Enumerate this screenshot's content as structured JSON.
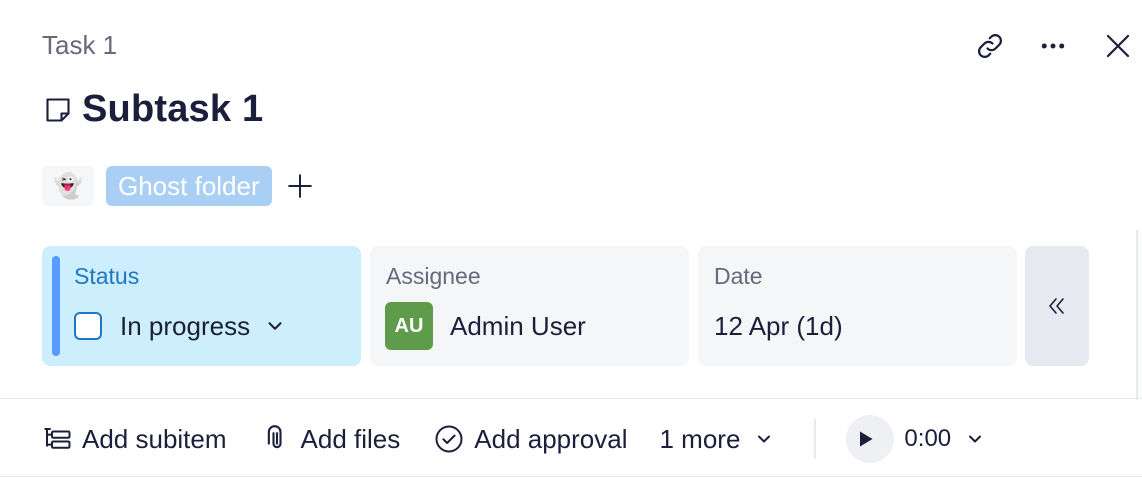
{
  "breadcrumb": {
    "parent": "Task 1"
  },
  "header": {
    "title": "Subtask 1",
    "actions": [
      "link-icon",
      "more-icon",
      "close-icon"
    ]
  },
  "tags": {
    "emoji": "👻",
    "folder_label": "Ghost folder",
    "add_icon": "plus-icon"
  },
  "fields": {
    "status": {
      "label": "Status",
      "value": "In progress",
      "accent": "#579bfc"
    },
    "assignee": {
      "label": "Assignee",
      "initials": "AU",
      "name": "Admin User",
      "avatar_color": "#5e9b4a"
    },
    "date": {
      "label": "Date",
      "value": "12 Apr (1d)"
    },
    "collapse_icon": "double-chevron-left-icon"
  },
  "footer": {
    "add_subitem": "Add subitem",
    "add_files": "Add files",
    "add_approval": "Add approval",
    "more": "1 more",
    "timer": "0:00"
  },
  "colors": {
    "tag_bg": "#a9cff5",
    "status_bg": "#cdeefc",
    "status_text": "#1f76c2"
  }
}
